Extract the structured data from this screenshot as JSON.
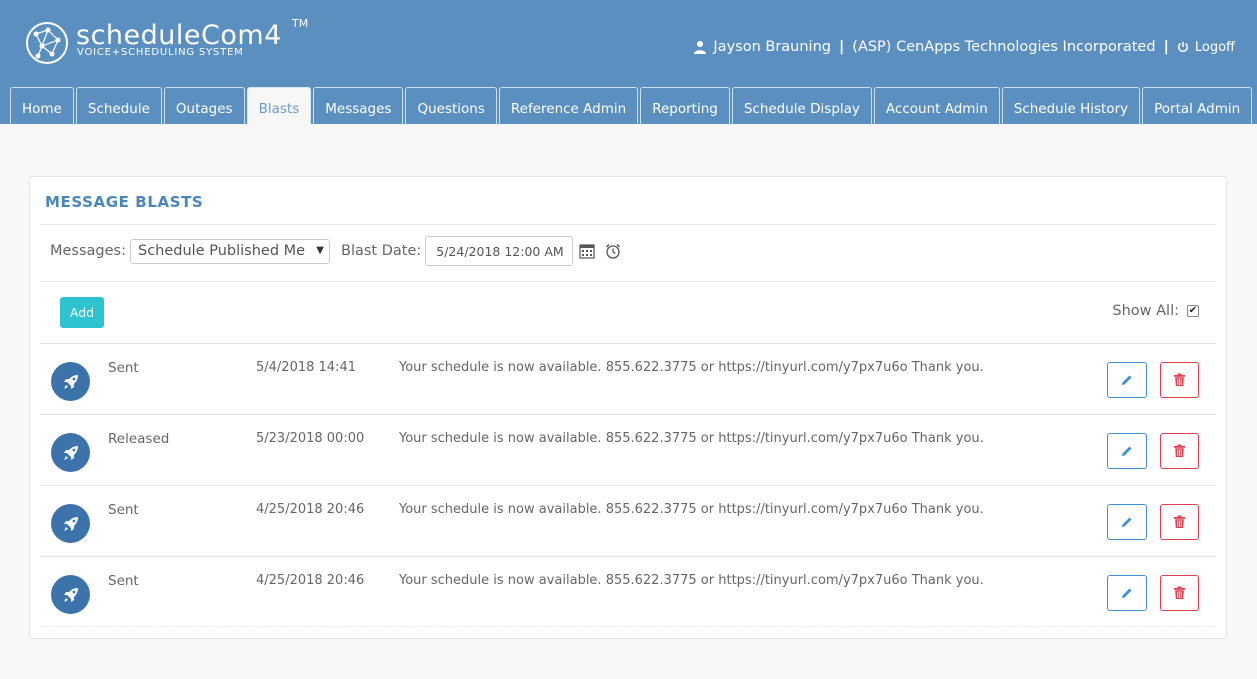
{
  "app": {
    "logo_name": "scheduleCom4",
    "logo_tm": "TM",
    "logo_subtitle": "VOICE+SCHEDULING SYSTEM"
  },
  "user": {
    "name": "Jayson Brauning",
    "organization": "(ASP) CenApps Technologies Incorporated",
    "logoff_label": "Logoff"
  },
  "tabs": [
    {
      "label": "Home"
    },
    {
      "label": "Schedule"
    },
    {
      "label": "Outages"
    },
    {
      "label": "Blasts",
      "active": true
    },
    {
      "label": "Messages"
    },
    {
      "label": "Questions"
    },
    {
      "label": "Reference Admin"
    },
    {
      "label": "Reporting"
    },
    {
      "label": "Schedule Display"
    },
    {
      "label": "Account Admin"
    },
    {
      "label": "Schedule History"
    },
    {
      "label": "Portal Admin"
    }
  ],
  "panel": {
    "title": "MESSAGE BLASTS",
    "messages_label": "Messages:",
    "messages_selected": "Schedule Published Me",
    "blast_date_label": "Blast Date:",
    "blast_date_value": "5/24/2018 12:00 AM",
    "add_label": "Add",
    "show_all_label": "Show All:",
    "show_all_checked": true
  },
  "blasts": [
    {
      "status": "Sent",
      "date": "5/4/2018 14:41",
      "message": "Your schedule is now available. 855.622.3775 or https://tinyurl.com/y7px7u6o Thank you."
    },
    {
      "status": "Released",
      "date": "5/23/2018 00:00",
      "message": "Your schedule is now available. 855.622.3775 or https://tinyurl.com/y7px7u6o Thank you."
    },
    {
      "status": "Sent",
      "date": "4/25/2018 20:46",
      "message": "Your schedule is now available. 855.622.3775 or https://tinyurl.com/y7px7u6o Thank you."
    },
    {
      "status": "Sent",
      "date": "4/25/2018 20:46",
      "message": "Your schedule is now available. 855.622.3775 or https://tinyurl.com/y7px7u6o Thank you."
    }
  ],
  "colors": {
    "header": "#5b8fc0",
    "accent_title": "#4a86bd",
    "add_button": "#2ec3d0",
    "edit": "#3f8fd4",
    "delete": "#e04050",
    "avatar": "#3c73aa"
  }
}
